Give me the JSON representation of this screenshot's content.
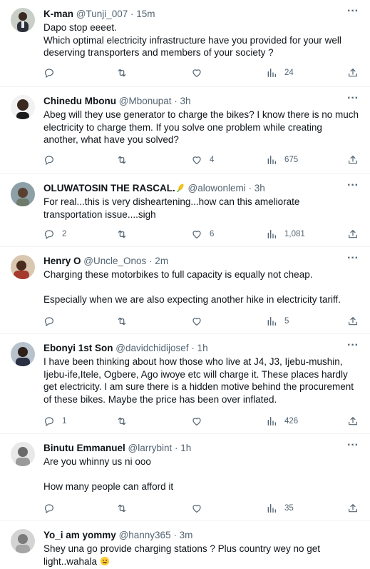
{
  "colors": {
    "text": "#0f1419",
    "secondary": "#536471",
    "divider": "#eff3f4"
  },
  "icons": [
    "more-icon",
    "reply-icon",
    "retweet-icon",
    "like-icon",
    "views-icon",
    "share-icon"
  ],
  "tweets": [
    {
      "name": "K-man",
      "handle": "@Tunji_007",
      "time": "· 15m",
      "body": "Dapo stop eeeet.\nWhich optimal electricity infrastructure have you provided for  your well deserving transporters and members of  your society ?",
      "replies": "",
      "retweets": "",
      "likes": "",
      "views": "24"
    },
    {
      "name": "Chinedu Mbonu",
      "handle": "@Mbonupat",
      "time": "· 3h",
      "body": "Abeg will they use generator to charge the bikes? I know there is no much electricity to charge them. If you solve one problem while creating another, what have you solved?",
      "replies": "",
      "retweets": "",
      "likes": "4",
      "views": "675"
    },
    {
      "name": "OLUWATOSIN THE RASCAL.",
      "handle": "@alowonlemi",
      "time": "· 3h",
      "body": "For real...this is very disheartening...how can this ameliorate  transportation issue....sigh",
      "replies": "2",
      "retweets": "",
      "likes": "6",
      "views": "1,081"
    },
    {
      "name": "Henry O",
      "handle": "@Uncle_Onos",
      "time": "· 2m",
      "body": "Charging these motorbikes to full capacity is equally not cheap.\n\nEspecially when we are also expecting another hike in electricity tariff.",
      "replies": "",
      "retweets": "",
      "likes": "",
      "views": "5"
    },
    {
      "name": "Ebonyi 1st Son",
      "handle": "@davidchidijosef",
      "time": "· 1h",
      "body": "I have been thinking about how those who live at J4, J3, Ijebu-mushin, Ijebu-ife,Itele, Ogbere, Ago iwoye etc will charge it. These places hardly get electricity.  I am sure there is a hidden motive behind the procurement of these bikes. Maybe the price has been over inflated.",
      "replies": "1",
      "retweets": "",
      "likes": "",
      "views": "426"
    },
    {
      "name": "Binutu Emmanuel",
      "handle": "@larrybint",
      "time": "· 1h",
      "body": "Are you whinny us ni ooo\n\nHow many people can afford it",
      "replies": "",
      "retweets": "",
      "likes": "",
      "views": "35"
    },
    {
      "name": "Yo_i am yommy",
      "handle": "@hanny365",
      "time": "· 3m",
      "body": "Shey una go provide charging stations ? Plus country wey no get light..wahala",
      "replies": "",
      "retweets": "",
      "likes": "",
      "views": ""
    }
  ]
}
